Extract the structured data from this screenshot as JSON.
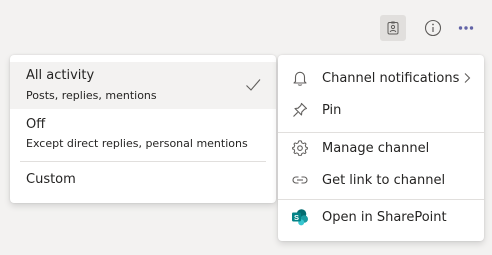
{
  "topbar": {
    "icons": [
      "contact-card-icon",
      "info-icon",
      "more-options-icon"
    ]
  },
  "notification_options": [
    {
      "title": "All activity",
      "subtitle": "Posts, replies, mentions",
      "selected": true
    },
    {
      "title": "Off",
      "subtitle": "Except direct replies, personal mentions",
      "selected": false
    },
    {
      "title": "Custom",
      "subtitle": "",
      "selected": false
    }
  ],
  "channel_menu": {
    "items": [
      {
        "label": "Channel notifications",
        "icon": "bell-icon",
        "has_submenu": true
      },
      {
        "label": "Pin",
        "icon": "pin-icon",
        "has_submenu": false
      },
      {
        "label": "Manage channel",
        "icon": "gear-icon",
        "has_submenu": false
      },
      {
        "label": "Get link to channel",
        "icon": "link-icon",
        "has_submenu": false
      },
      {
        "label": "Open in SharePoint",
        "icon": "sharepoint-icon",
        "has_submenu": false
      }
    ]
  },
  "colors": {
    "background": "#f3f2f1",
    "menu_bg": "#ffffff",
    "hover_bg": "#f3f2f1",
    "accent": "#6264a7",
    "sharepoint": "#038387"
  }
}
